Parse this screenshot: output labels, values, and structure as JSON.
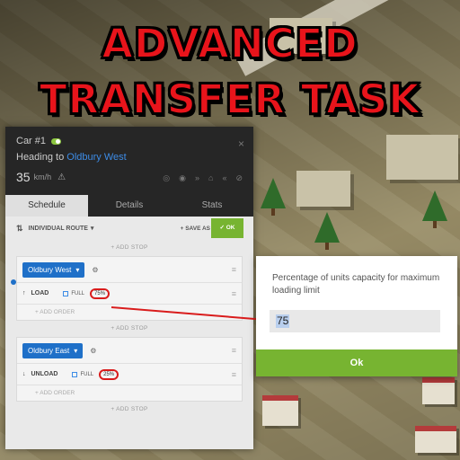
{
  "title": {
    "line1": "ADVANCED",
    "line2": "TRANSFER TASK"
  },
  "car_panel": {
    "car_name": "Car #1",
    "toggle_state": "on",
    "heading_prefix": "Heading to",
    "heading_destination": "Oldbury West",
    "speed_value": "35",
    "speed_unit": "km/h",
    "close_icon": "×",
    "action_icons": [
      "target-icon",
      "eye-icon",
      "forward-icon",
      "depot-icon",
      "reverse-icon",
      "unlink-icon"
    ],
    "tabs": [
      "Schedule",
      "Details",
      "Stats"
    ],
    "active_tab": "Schedule"
  },
  "schedule": {
    "route_type": "INDIVIDUAL ROUTE",
    "save_as": "SAVE AS",
    "ok": "OK",
    "add_stop": "ADD STOP",
    "add_order": "ADD ORDER",
    "stops": [
      {
        "name": "Oldbury West",
        "task": "LOAD",
        "full_label": "FULL",
        "percent": "75%"
      },
      {
        "name": "Oldbury East",
        "task": "UNLOAD",
        "full_label": "FULL",
        "percent": "25%"
      }
    ]
  },
  "dialog": {
    "message": "Percentage of units capacity for maximum loading limit",
    "input_value": "75",
    "ok_label": "Ok"
  },
  "colors": {
    "title_red": "#e8141b",
    "highlight_red": "#d91c1c",
    "accent_blue": "#1f70c8",
    "ok_green": "#77b431"
  }
}
